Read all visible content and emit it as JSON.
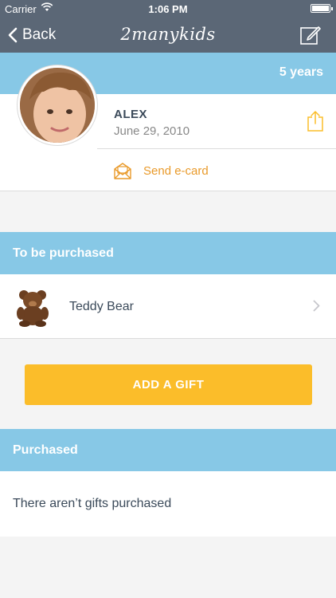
{
  "status_bar": {
    "carrier": "Carrier",
    "time": "1:06 PM"
  },
  "nav": {
    "back_label": "Back",
    "title": "2manykids"
  },
  "child": {
    "age": "5 years",
    "name": "ALEX",
    "birthdate": "June 29, 2010"
  },
  "actions": {
    "send_ecard_label": "Send e-card"
  },
  "to_purchase": {
    "header": "To be purchased",
    "items": [
      {
        "name": "Teddy Bear"
      }
    ]
  },
  "add_gift_label": "ADD A GIFT",
  "purchased": {
    "header": "Purchased",
    "empty_text": "There aren’t gifts purchased"
  },
  "colors": {
    "nav": "#5b6776",
    "section": "#87c8e6",
    "accent": "#fbbd2a",
    "ecard": "#e99a2a"
  }
}
